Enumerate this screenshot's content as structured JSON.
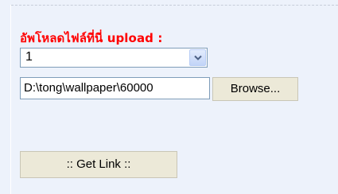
{
  "upload": {
    "label": "อัพโหลดไฟล์ที่นี่ upload :"
  },
  "select": {
    "value": "1",
    "arrow_icon": "chevron-down-icon"
  },
  "file": {
    "path": "D:\\tong\\wallpaper\\60000",
    "browse_label": "Browse..."
  },
  "get_link": {
    "label": ":: Get Link ::"
  },
  "colors": {
    "panel_bg": "#edf2fb",
    "label_red": "#ff0000",
    "button_bg": "#ece9d8",
    "input_border": "#7f9db9"
  }
}
